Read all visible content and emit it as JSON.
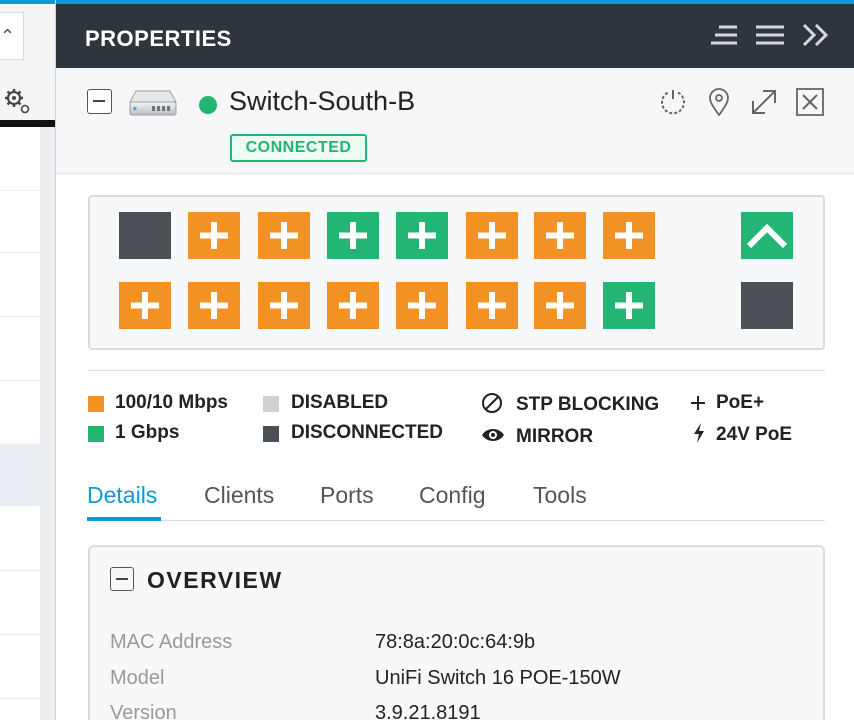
{
  "header": {
    "title": "PROPERTIES"
  },
  "device": {
    "name": "Switch-South-B",
    "status_badge": "CONNECTED",
    "status_color": "#23b573"
  },
  "colors": {
    "accent": "#0b9ad8",
    "port_100_10": "#f39325",
    "port_1g": "#23b573",
    "port_disabled": "#d1d1d1",
    "port_disconnected": "#4b5057"
  },
  "ports": {
    "row1": [
      "disconnected",
      "100-10-poe",
      "100-10-poe",
      "1g-poe",
      "1g-poe",
      "100-10-poe",
      "100-10-poe",
      "100-10-poe"
    ],
    "row2": [
      "100-10-poe",
      "100-10-poe",
      "100-10-poe",
      "100-10-poe",
      "100-10-poe",
      "100-10-poe",
      "100-10-poe",
      "1g-poe"
    ],
    "uplink_top": "1g-uplink",
    "uplink_bottom": "disconnected"
  },
  "legend": {
    "speed_100_10": "100/10 Mbps",
    "speed_1g": "1 Gbps",
    "disabled": "DISABLED",
    "disconnected": "DISCONNECTED",
    "stp_blocking": "STP BLOCKING",
    "mirror": "MIRROR",
    "poe_plus": "PoE+",
    "poe_24v": "24V PoE"
  },
  "tabs": [
    {
      "label": "Details",
      "active": true
    },
    {
      "label": "Clients",
      "active": false
    },
    {
      "label": "Ports",
      "active": false
    },
    {
      "label": "Config",
      "active": false
    },
    {
      "label": "Tools",
      "active": false
    }
  ],
  "overview": {
    "title": "OVERVIEW",
    "rows": [
      {
        "label": "MAC Address",
        "value": "78:8a:20:0c:64:9b"
      },
      {
        "label": "Model",
        "value": "UniFi Switch 16 POE-150W"
      },
      {
        "label": "Version",
        "value": "3.9.21.8191"
      }
    ]
  }
}
